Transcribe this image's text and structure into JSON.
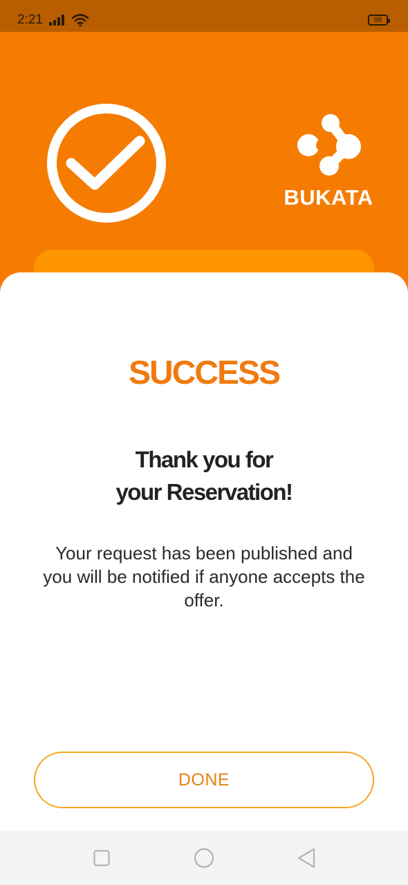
{
  "status_bar": {
    "time": "2:21",
    "battery_level": "98",
    "icons": [
      "signal-icon",
      "wifi-icon",
      "battery-icon"
    ]
  },
  "header": {
    "icon": "check-circle-icon",
    "brand_name": "BUKATA"
  },
  "content": {
    "title": "SUCCESS",
    "heading_line1": "Thank you for",
    "heading_line2": "your Reservation!",
    "message": "Your request has been published and you will be notified if anyone accepts the offer."
  },
  "actions": {
    "done_label": "DONE"
  },
  "nav_bar": {
    "icons": [
      "recent-apps-icon",
      "home-icon",
      "back-icon"
    ]
  },
  "colors": {
    "brand_orange": "#F57C00",
    "status_bar": "#B85E00",
    "card_orange": "#FF9500",
    "accent_text": "#F07A0F",
    "button_border": "#F5A623"
  }
}
